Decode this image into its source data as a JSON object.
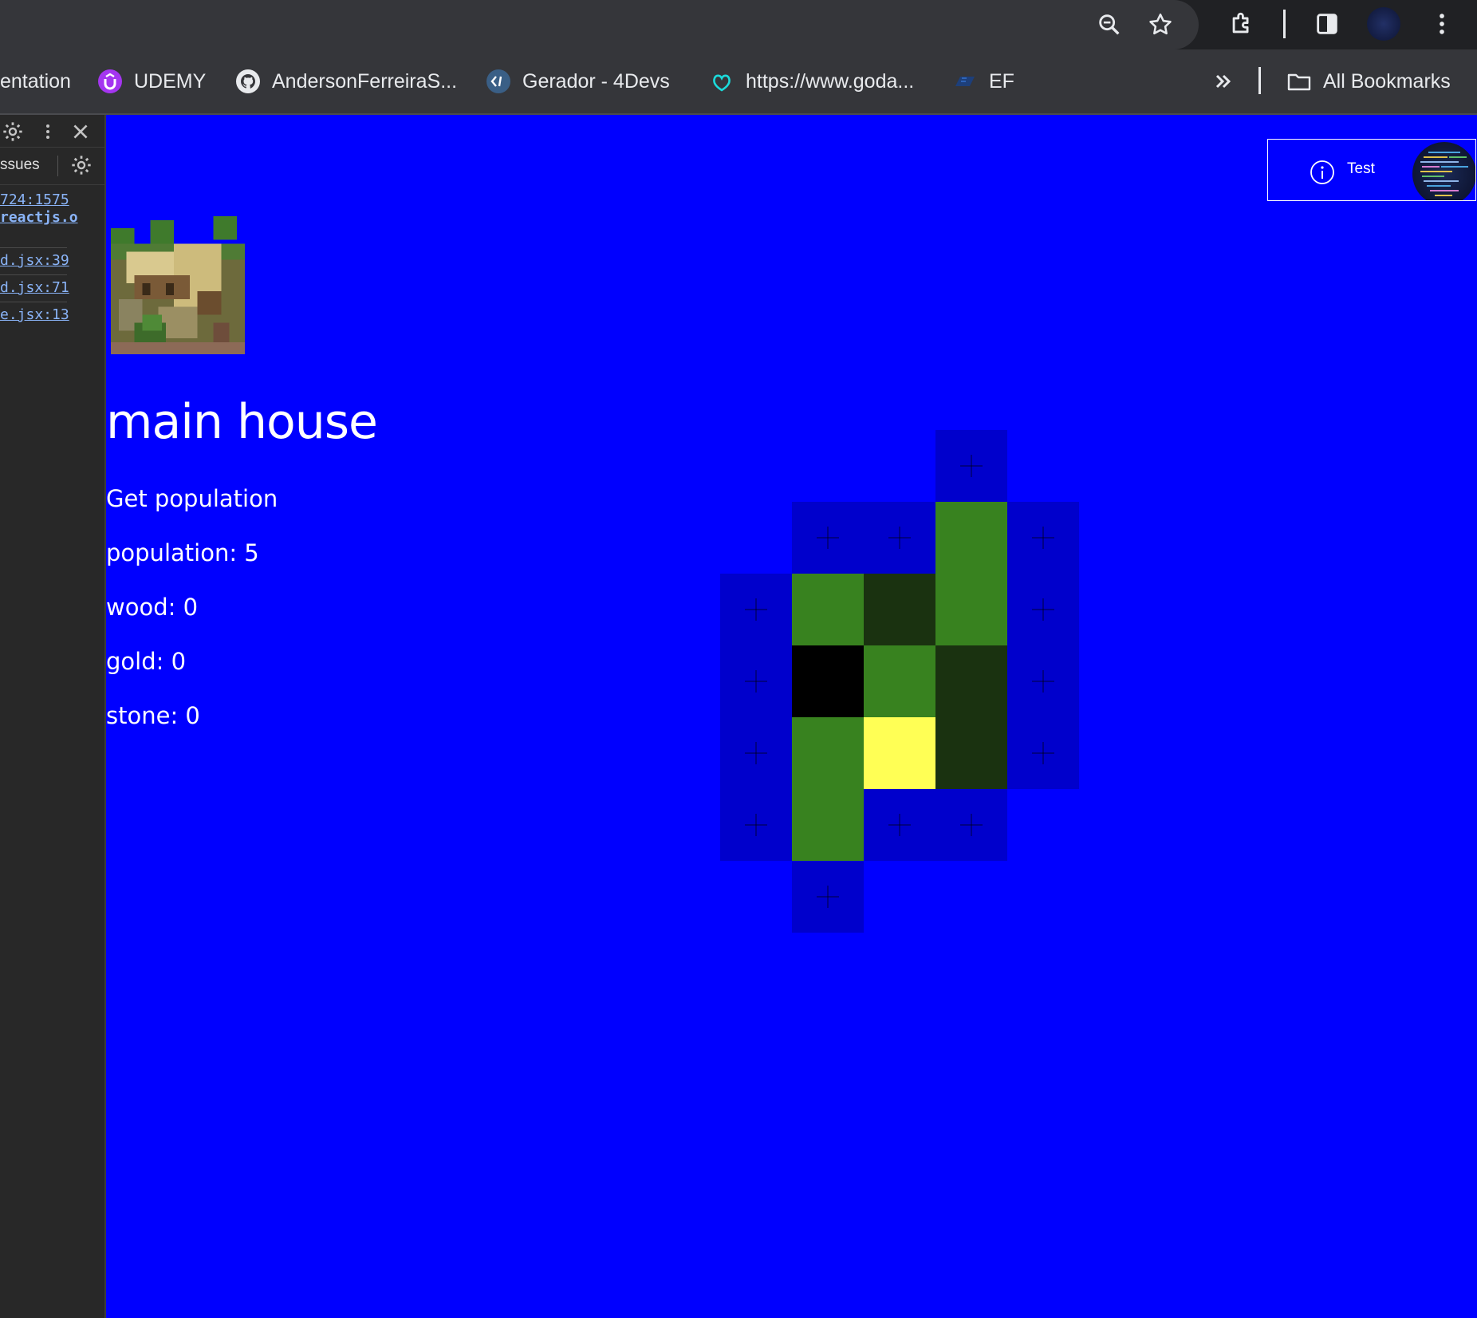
{
  "browser": {
    "toolbar_icons": [
      "zoom-icon",
      "bookmark-star-icon",
      "extensions-icon",
      "side-panel-icon",
      "profile-avatar",
      "menu-dots-icon"
    ],
    "bookmarks": [
      {
        "label": "entation",
        "icon": "bookmark-favicon"
      },
      {
        "label": "UDEMY",
        "icon": "udemy-icon",
        "color": "#a435f0"
      },
      {
        "label": "AndersonFerreiraS...",
        "icon": "github-icon"
      },
      {
        "label": "Gerador  - 4Devs",
        "icon": "4devs-icon"
      },
      {
        "label": "https://www.goda...",
        "icon": "godaddy-icon"
      },
      {
        "label": "EF",
        "icon": "ef-icon"
      }
    ],
    "overflow_icon": "chevron-double-right-icon",
    "all_bookmarks_label": "All Bookmarks"
  },
  "devtools": {
    "issues_tab": "ssues",
    "links": [
      "724:1575",
      "reactjs.o",
      "d.jsx:39",
      "d.jsx:71",
      "e.jsx:13"
    ]
  },
  "app": {
    "title": "main house",
    "get_population_label": "Get population",
    "stats": {
      "population": "population: 5",
      "wood": "wood: 0",
      "gold": "gold: 0",
      "stone": "stone: 0"
    },
    "test_button_label": "Test",
    "colors": {
      "background": "#0000ff",
      "empty_slot": "#0000cc",
      "grass": "#38821f",
      "forest": "#1a3210",
      "mine": "#000000",
      "gold": "#ffff55"
    },
    "tile_types": [
      "empty",
      "grass",
      "forest",
      "mine",
      "gold"
    ]
  }
}
